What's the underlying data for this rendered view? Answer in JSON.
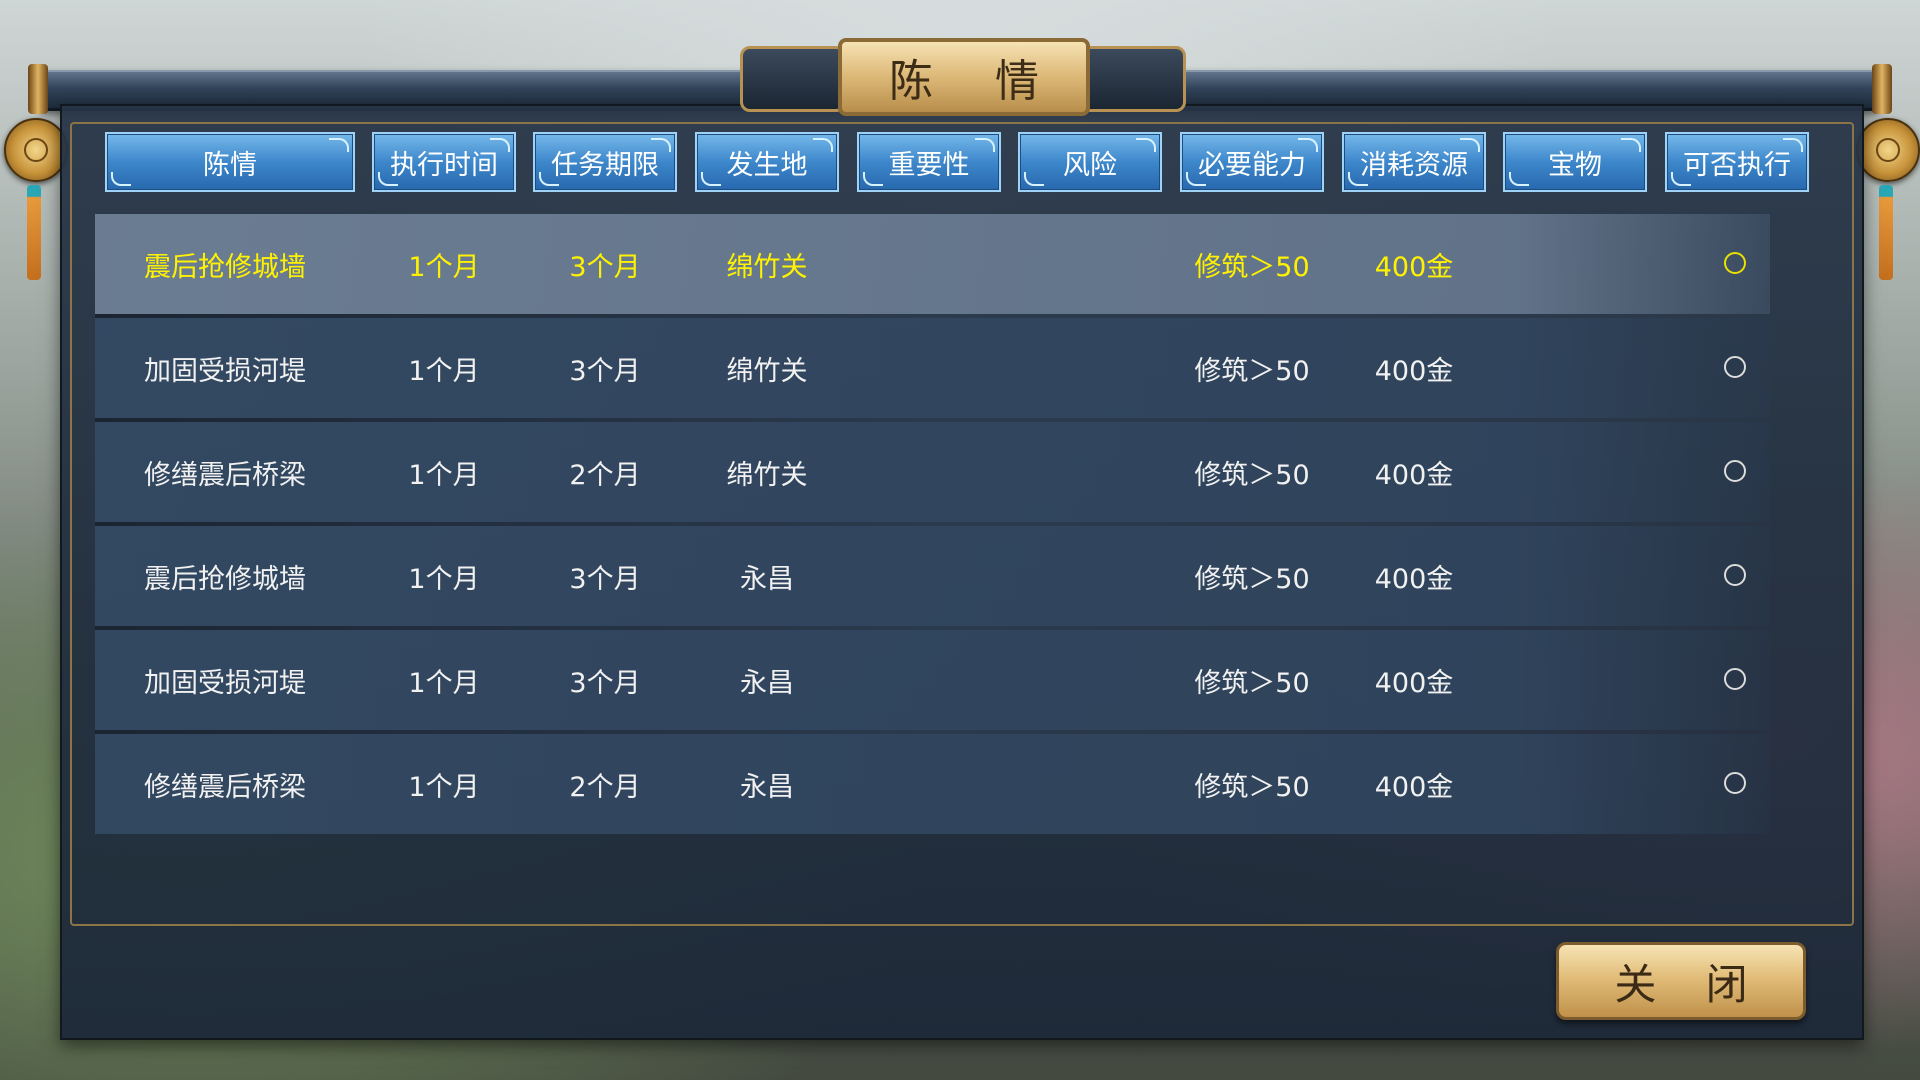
{
  "window": {
    "title": "陈 情"
  },
  "tabs": [
    {
      "label": "陈情"
    },
    {
      "label": "执行时间"
    },
    {
      "label": "任务期限"
    },
    {
      "label": "发生地"
    },
    {
      "label": "重要性"
    },
    {
      "label": "风险"
    },
    {
      "label": "必要能力"
    },
    {
      "label": "消耗资源"
    },
    {
      "label": "宝物"
    },
    {
      "label": "可否执行"
    }
  ],
  "rows": [
    {
      "name": "震后抢修城墙",
      "exec_time": "1个月",
      "deadline": "3个月",
      "location": "绵竹关",
      "ability": "修筑＞50",
      "resource": "400金",
      "selected": true
    },
    {
      "name": "加固受损河堤",
      "exec_time": "1个月",
      "deadline": "3个月",
      "location": "绵竹关",
      "ability": "修筑＞50",
      "resource": "400金",
      "selected": false
    },
    {
      "name": "修缮震后桥梁",
      "exec_time": "1个月",
      "deadline": "2个月",
      "location": "绵竹关",
      "ability": "修筑＞50",
      "resource": "400金",
      "selected": false
    },
    {
      "name": "震后抢修城墙",
      "exec_time": "1个月",
      "deadline": "3个月",
      "location": "永昌",
      "ability": "修筑＞50",
      "resource": "400金",
      "selected": false
    },
    {
      "name": "加固受损河堤",
      "exec_time": "1个月",
      "deadline": "3个月",
      "location": "永昌",
      "ability": "修筑＞50",
      "resource": "400金",
      "selected": false
    },
    {
      "name": "修缮震后桥梁",
      "exec_time": "1个月",
      "deadline": "2个月",
      "location": "永昌",
      "ability": "修筑＞50",
      "resource": "400金",
      "selected": false
    }
  ],
  "footer": {
    "close_label": "关 闭"
  },
  "colors": {
    "selected_text": "#fff200",
    "tab_blue": "#3d87cb",
    "gold": "#dcb877"
  }
}
